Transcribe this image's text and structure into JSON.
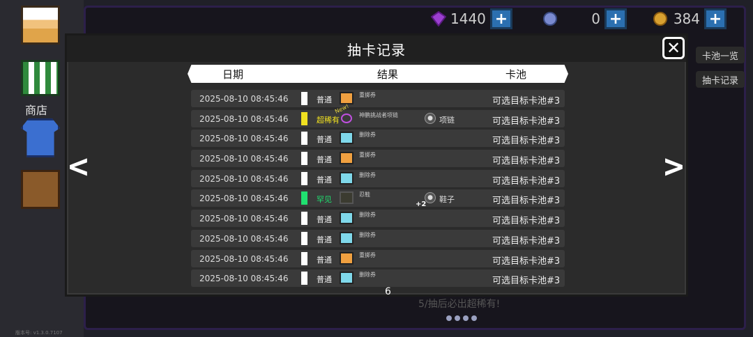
{
  "currencies": [
    {
      "icon": "gem-icon",
      "amount": "1440",
      "color": "#9b3fd0"
    },
    {
      "icon": "crystal-icon",
      "amount": "0",
      "color": "#7a8ad0"
    },
    {
      "icon": "coin-icon",
      "amount": "384",
      "color": "#d8a030"
    }
  ],
  "plus_label": "+",
  "sidebar": {
    "shop_label": "商店",
    "version": "版本号: v1.3.0.7107"
  },
  "side_tabs": [
    "卡池一览",
    "抽卡记录"
  ],
  "background_hint": "5/抽后必出超稀有!",
  "modal": {
    "title": "抽卡记录",
    "close_label": "✕",
    "columns": {
      "date": "日期",
      "result": "结果",
      "pool": "卡池"
    },
    "prev_label": "<",
    "next_label": ">",
    "page": "6",
    "records": [
      {
        "date": "2025-08-10 08:45:46",
        "rarity": "普通",
        "rarity_color": "#ffffff",
        "item": "重掷券",
        "icon": "reroll-ticket-icon",
        "pool": "可选目标卡池#3"
      },
      {
        "date": "2025-08-10 08:45:46",
        "rarity": "超稀有",
        "rarity_color": "#f0e020",
        "item": "神鹏挑战者项链",
        "icon": "necklace-icon",
        "new": "New!",
        "extra_icon": "necklace-icon",
        "extra_label": "项链",
        "pool": "可选目标卡池#3"
      },
      {
        "date": "2025-08-10 08:45:46",
        "rarity": "普通",
        "rarity_color": "#ffffff",
        "item": "删除券",
        "icon": "delete-ticket-icon",
        "pool": "可选目标卡池#3"
      },
      {
        "date": "2025-08-10 08:45:46",
        "rarity": "普通",
        "rarity_color": "#ffffff",
        "item": "重掷券",
        "icon": "reroll-ticket-icon",
        "pool": "可选目标卡池#3"
      },
      {
        "date": "2025-08-10 08:45:46",
        "rarity": "普通",
        "rarity_color": "#ffffff",
        "item": "删除券",
        "icon": "delete-ticket-icon",
        "pool": "可选目标卡池#3"
      },
      {
        "date": "2025-08-10 08:45:46",
        "rarity": "罕见",
        "rarity_color": "#20e070",
        "item": "忍鞋",
        "icon": "boot-icon",
        "extra_icon": "boot-icon",
        "extra_label": "鞋子",
        "plus": "+2",
        "pool": "可选目标卡池#3"
      },
      {
        "date": "2025-08-10 08:45:46",
        "rarity": "普通",
        "rarity_color": "#ffffff",
        "item": "删除券",
        "icon": "delete-ticket-icon",
        "pool": "可选目标卡池#3"
      },
      {
        "date": "2025-08-10 08:45:46",
        "rarity": "普通",
        "rarity_color": "#ffffff",
        "item": "删除券",
        "icon": "delete-ticket-icon",
        "pool": "可选目标卡池#3"
      },
      {
        "date": "2025-08-10 08:45:46",
        "rarity": "普通",
        "rarity_color": "#ffffff",
        "item": "重掷券",
        "icon": "reroll-ticket-icon",
        "pool": "可选目标卡池#3"
      },
      {
        "date": "2025-08-10 08:45:46",
        "rarity": "普通",
        "rarity_color": "#ffffff",
        "item": "删除券",
        "icon": "delete-ticket-icon",
        "pool": "可选目标卡池#3"
      }
    ]
  }
}
